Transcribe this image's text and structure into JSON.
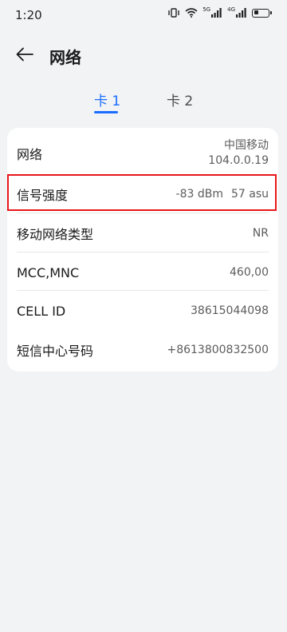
{
  "status_bar": {
    "time": "1:20",
    "sig1_label": "5G",
    "sig2_label": "4G"
  },
  "header": {
    "title": "网络"
  },
  "tabs": [
    {
      "label": "卡 1",
      "selected": true
    },
    {
      "label": "卡 2",
      "selected": false
    }
  ],
  "rows": {
    "network": {
      "label": "网络",
      "value_line1": "中国移动",
      "value_line2": "104.0.0.19"
    },
    "signal": {
      "label": "信号强度",
      "value_dbm": "-83 dBm",
      "value_asu": "57 asu"
    },
    "type": {
      "label": "移动网络类型",
      "value": "NR"
    },
    "mcc": {
      "label": "MCC,MNC",
      "value": "460,00"
    },
    "cell": {
      "label": "CELL ID",
      "value": "38615044098"
    },
    "smsc": {
      "label": "短信中心号码",
      "value": "+8613800832500"
    }
  },
  "colors": {
    "accent": "#1a6dff",
    "highlight": "#e8161b",
    "background": "#f1f3f5"
  }
}
